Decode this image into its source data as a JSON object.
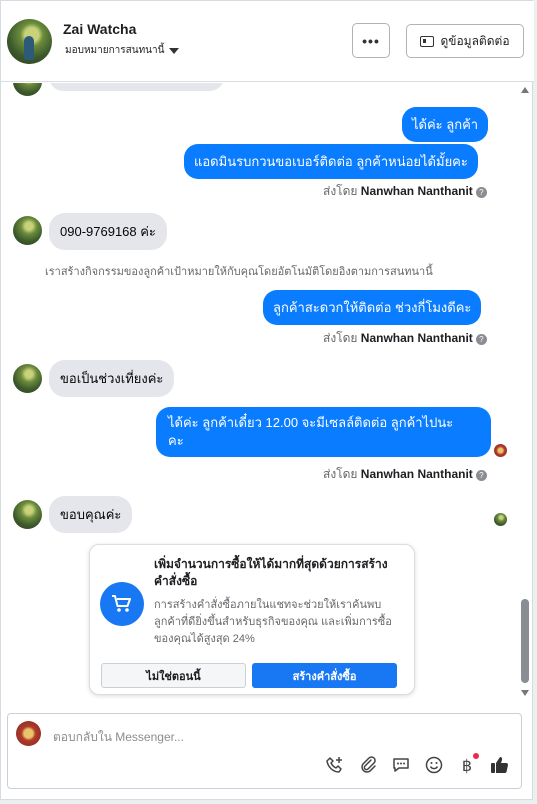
{
  "header": {
    "name": "Zai Watcha",
    "assign_label": "มอบหมายการสนทนานี้",
    "more_label": "•••",
    "contact_label": "ดูข้อมูลติดต่อ"
  },
  "messages": {
    "out1": "ได้ค่ะ ลูกค้า",
    "out2": "แอดมินรบกวนขอเบอร์ติดต่อ ลูกค้าหน่อยได้มั้ยคะ",
    "sent_by_prefix": "ส่งโดย",
    "sender": "Nanwhan Nanthanit",
    "in_phone": "090-9769168 ค่ะ",
    "system_note": "เราสร้างกิจกรรมของลูกค้าเป้าหมายให้กับคุณโดยอัตโนมัติโดยอิงตามการสนทนานี้",
    "out3": "ลูกค้าสะดวกให้ติดต่อ ช่วงกี่โมงดีคะ",
    "in_time": "ขอเป็นช่วงเที่ยงค่ะ",
    "out4_line1": "ได้ค่ะ ลูกค้าเดี๋ยว 12.00 จะมีเซลล์ติดต่อ ลูกค้าไปนะ",
    "out4_line2": "คะ",
    "in_thanks": "ขอบคุณค่ะ"
  },
  "promo": {
    "title": "เพิ่มจำนวนการซื้อให้ได้มากที่สุดด้วยการสร้างคำสั่งซื้อ",
    "body": "การสร้างคำสั่งซื้อภายในแชทจะช่วยให้เราค้นพบลูกค้าที่ดียิ่งขึ้นสำหรับธุรกิจของคุณ และเพิ่มการซื้อของคุณได้สูงสุด 24%",
    "not_now": "ไม่ใช่ตอนนี้",
    "create_order": "สร้างคำสั่งซื้อ"
  },
  "composer": {
    "placeholder": "ตอบกลับใน Messenger..."
  },
  "icons": [
    "phone-add-icon",
    "attach-icon",
    "saved-reply-icon",
    "emoji-icon",
    "baht-icon",
    "thumbs-up-icon"
  ],
  "colors": {
    "accent": "#0a7cff",
    "button_blue": "#1877f2"
  }
}
